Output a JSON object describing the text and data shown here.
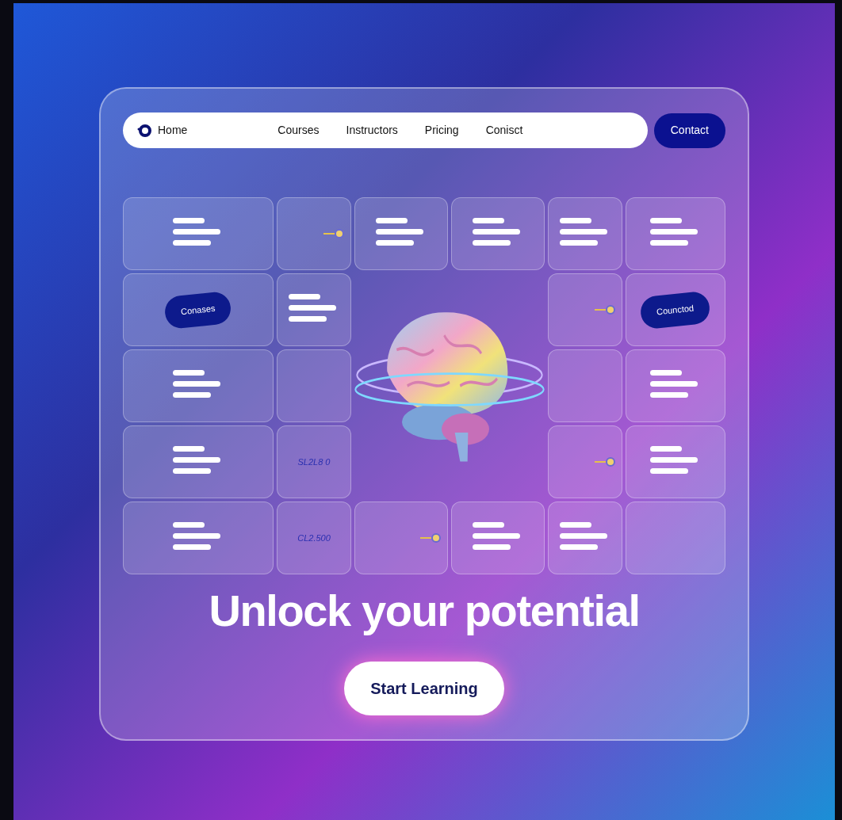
{
  "nav": {
    "items": [
      {
        "label": "Home"
      },
      {
        "label": "Courses"
      },
      {
        "label": "Instructors"
      },
      {
        "label": "Pricing"
      },
      {
        "label": "Conisct"
      }
    ],
    "cta": "Contact"
  },
  "grid": {
    "rows": [
      [
        {
          "kind": "lines"
        },
        {
          "kind": "dot"
        },
        {
          "kind": "lines"
        },
        {
          "kind": "lines"
        },
        {
          "kind": "lines"
        },
        {
          "kind": "lines"
        }
      ],
      [
        {
          "kind": "pill",
          "label": "Conases"
        },
        {
          "kind": "lines"
        },
        {
          "kind": "dot"
        },
        {
          "kind": "pill",
          "label": "Counctod"
        }
      ],
      [
        {
          "kind": "lines"
        },
        {
          "kind": "blank"
        },
        {
          "kind": "blank"
        },
        {
          "kind": "lines"
        }
      ],
      [
        {
          "kind": "lines"
        },
        {
          "kind": "note",
          "label": "SL2L8 0"
        },
        {
          "kind": "dot"
        },
        {
          "kind": "lines"
        }
      ],
      [
        {
          "kind": "lines"
        },
        {
          "kind": "note",
          "label": "CL2.500"
        },
        {
          "kind": "dot"
        },
        {
          "kind": "lines"
        },
        {
          "kind": "lines"
        },
        {
          "kind": "blank"
        }
      ]
    ]
  },
  "hero": {
    "title": "Unlock your potential",
    "button": "Start Learning"
  }
}
